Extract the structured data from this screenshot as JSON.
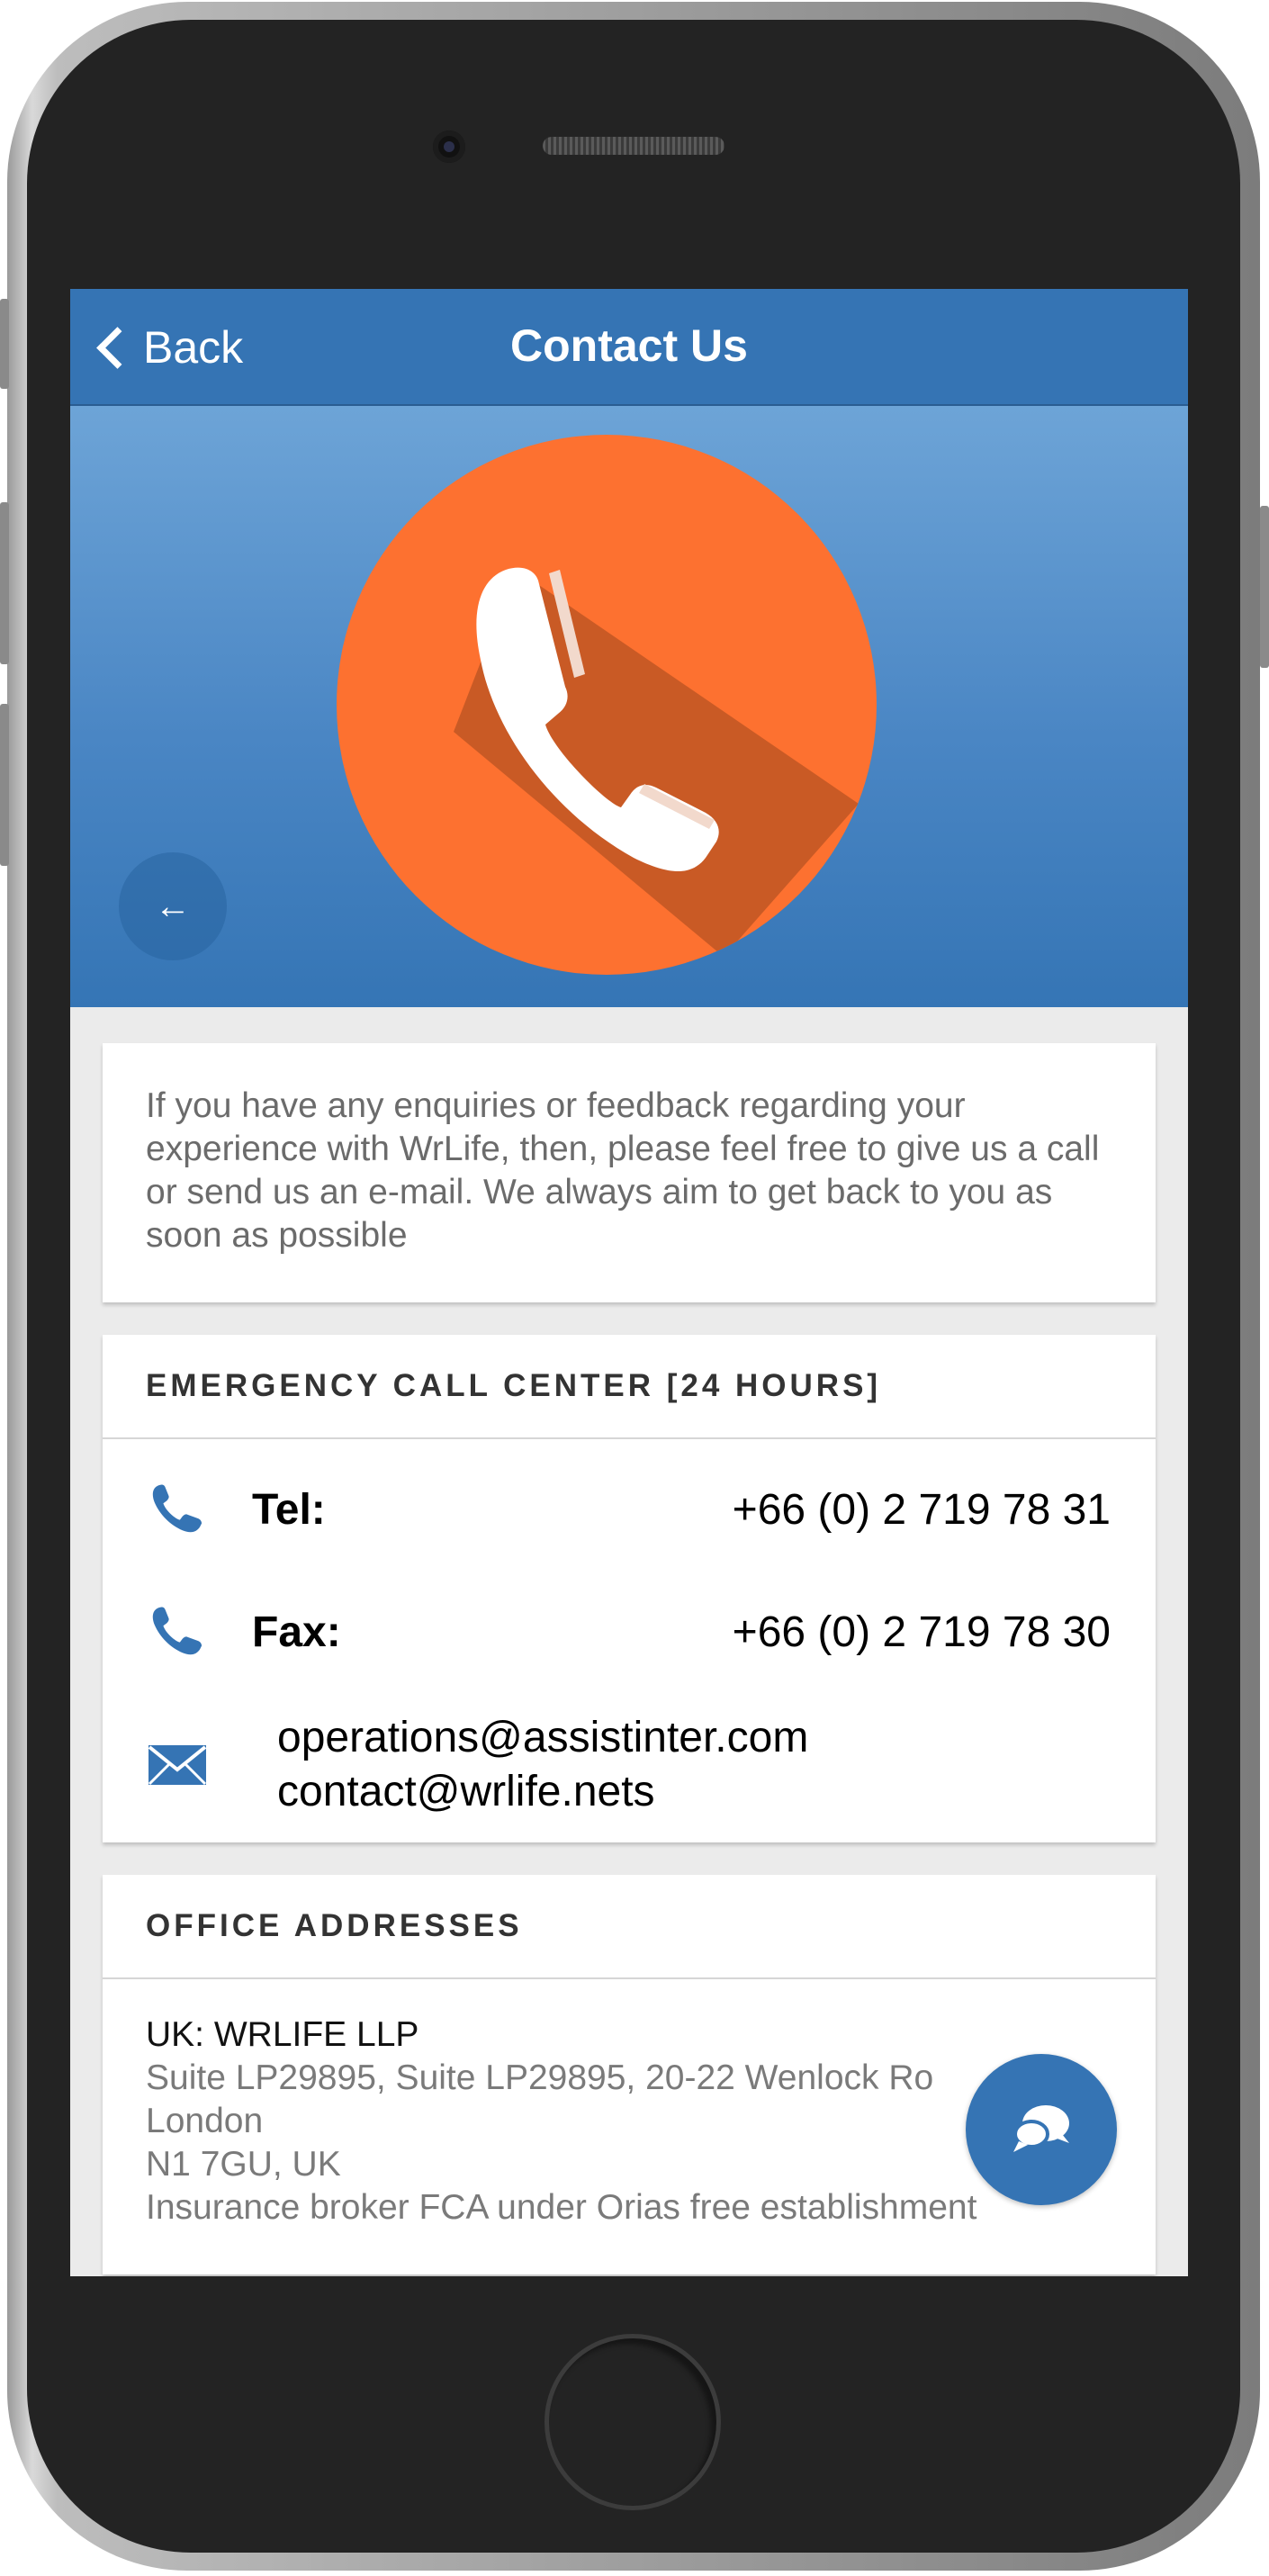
{
  "header": {
    "back_label": "Back",
    "title": "Contact Us"
  },
  "hero": {
    "icon": "phone-handset-icon",
    "circle_color": "#fd7130",
    "back_icon": "arrow-left-icon"
  },
  "intro_text": "If you have any enquiries or feedback regarding your experience with WrLife, then, please feel free to give us a call or send us an e-mail. We always aim to get back to you as soon as possible",
  "emergency": {
    "title": "EMERGENCY CALL CENTER [24 HOURS]",
    "tel_label": "Tel:",
    "tel_value": "+66 (0) 2 719 78 31",
    "fax_label": "Fax:",
    "fax_value": "+66 (0) 2 719 78 30",
    "emails": [
      "operations@assistinter.com",
      "contact@wrlife.nets"
    ]
  },
  "offices": {
    "title": "OFFICE ADDRESSES",
    "uk_name": "UK: WRLIFE LLP",
    "lines": [
      "Suite LP29895, Suite LP29895, 20-22 Wenlock Ro",
      "London",
      "N1 7GU, UK",
      "Insurance broker FCA under Orias free establishment"
    ]
  },
  "fab": {
    "icon": "chat-bubbles-icon"
  },
  "colors": {
    "primary": "#3574b4",
    "accent": "#fd7130",
    "background": "#ebebeb"
  }
}
